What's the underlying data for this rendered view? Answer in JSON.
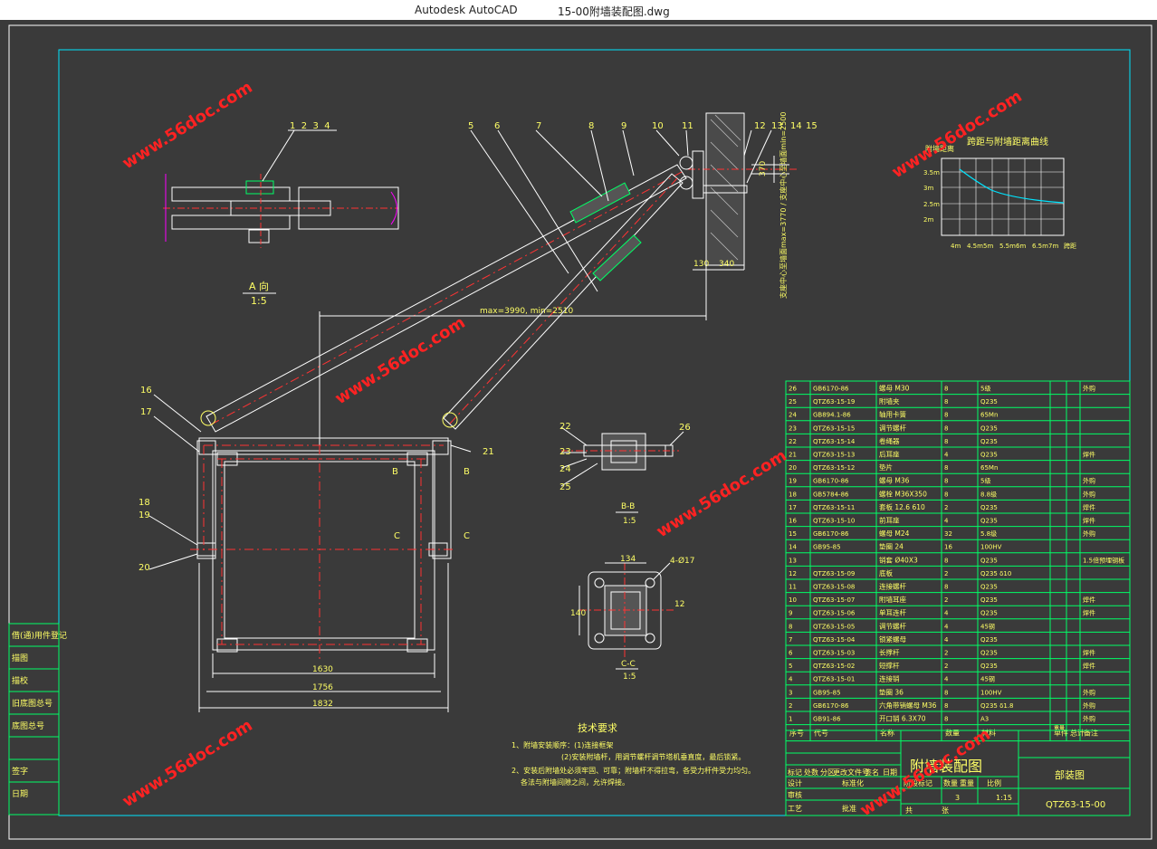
{
  "window": {
    "app_name": "Autodesk AutoCAD",
    "file_name": "15-00附墙装配图.dwg"
  },
  "drawing": {
    "view_a_label": "A 向",
    "view_a_scale": "1:5",
    "callouts_top": [
      "1",
      "2",
      "3",
      "4",
      "5",
      "6",
      "7",
      "8",
      "9",
      "10",
      "11",
      "12",
      "13",
      "14",
      "15"
    ],
    "callouts_left": [
      "16",
      "17",
      "18",
      "19",
      "20"
    ],
    "callout_21": "21",
    "section_b_callouts": [
      "22",
      "23",
      "24",
      "25",
      "26"
    ],
    "dim_reach": "max=3990, min=2510",
    "dim_wall_left": "130",
    "dim_wall_right": "340",
    "dim_vertical_1": "370",
    "dim_vertical_note": "支座中心至墙面max=3770 / 支座中心至墙面min=2500",
    "dim_1630": "1630",
    "dim_1756": "1756",
    "dim_1832": "1832",
    "mark_b": "B",
    "mark_c": "C",
    "section_bb_label": "B-B",
    "section_bb_scale": "1:5",
    "section_cc_label": "C-C",
    "section_cc_scale": "1:5",
    "section_cc_hole": "4-Ø17",
    "section_cc_dim_top": "134",
    "section_cc_dim_left": "140",
    "section_cc_dim_right": "12",
    "chart_title": "跨距与附墙距离曲线",
    "chart_ylabel": "附墙距离",
    "chart_yticks": [
      "3.5m",
      "3m",
      "2.5m",
      "2m"
    ],
    "chart_xticks": [
      "4m",
      "4.5m",
      "5m",
      "5.5m",
      "6m",
      "6.5m",
      "7m",
      "跨距"
    ]
  },
  "tech": {
    "title": "技术要求",
    "lines": [
      "1、附墙安装顺序：(1)连接框架",
      "(2)安装附墙杆，用调节螺杆调节塔机垂直度，最后锁紧。",
      "2、安装后附墙处必须牢固、可靠；附墙杆不得拉弯，各受力杆件受力均匀。",
      "各法与附墙间隙之间，允许焊接。"
    ]
  },
  "bom": {
    "header": [
      "序号",
      "代号",
      "名称",
      "数量",
      "材料",
      "单件",
      "总计",
      "备注"
    ],
    "header_weight": "重量",
    "rows": [
      [
        "26",
        "GB6170-86",
        "螺母 M30",
        "8",
        "5级",
        "",
        "",
        "外购"
      ],
      [
        "25",
        "QTZ63-15-19",
        "附墙夹",
        "8",
        "Q235",
        "",
        "",
        ""
      ],
      [
        "24",
        "GB894.1-86",
        "轴用卡簧",
        "8",
        "65Mn",
        "",
        "",
        ""
      ],
      [
        "23",
        "QTZ63-15-15",
        "调节螺杆",
        "8",
        "Q235",
        "",
        "",
        ""
      ],
      [
        "22",
        "QTZ63-15-14",
        "卷绳器",
        "8",
        "Q235",
        "",
        "",
        ""
      ],
      [
        "21",
        "QTZ63-15-13",
        "后耳座",
        "4",
        "Q235",
        "",
        "",
        "焊件"
      ],
      [
        "20",
        "QTZ63-15-12",
        "垫片",
        "8",
        "65Mn",
        "",
        "",
        ""
      ],
      [
        "19",
        "GB6170-86",
        "螺母 M36",
        "8",
        "5级",
        "",
        "",
        "外购"
      ],
      [
        "18",
        "GB5784-86",
        "螺栓 M36X350",
        "8",
        "8.8级",
        "",
        "",
        "外购"
      ],
      [
        "17",
        "QTZ63-15-11",
        "套板 12.6 610",
        "2",
        "Q235",
        "",
        "",
        "焊件"
      ],
      [
        "16",
        "QTZ63-15-10",
        "前耳座",
        "4",
        "Q235",
        "",
        "",
        "焊件"
      ],
      [
        "15",
        "GB6170-86",
        "螺母 M24",
        "32",
        "5.8级",
        "",
        "",
        "外购"
      ],
      [
        "14",
        "GB95-85",
        "垫圈 24",
        "16",
        "100HV",
        "",
        "",
        ""
      ],
      [
        "13",
        "",
        "销套 Ø40X3",
        "8",
        "Q235",
        "",
        "",
        "1.5倍预埋钢板"
      ],
      [
        "12",
        "QTZ63-15-09",
        "底板",
        "2",
        "Q235 δ10",
        "",
        "",
        ""
      ],
      [
        "11",
        "QTZ63-15-08",
        "连接螺杆",
        "8",
        "Q235",
        "",
        "",
        ""
      ],
      [
        "10",
        "QTZ63-15-07",
        "附墙耳座",
        "2",
        "Q235",
        "",
        "",
        "焊件"
      ],
      [
        "9",
        "QTZ63-15-06",
        "单耳连杆",
        "4",
        "Q235",
        "",
        "",
        "焊件"
      ],
      [
        "8",
        "QTZ63-15-05",
        "调节螺杆",
        "4",
        "45钢",
        "",
        "",
        ""
      ],
      [
        "7",
        "QTZ63-15-04",
        "锁紧螺母",
        "4",
        "Q235",
        "",
        "",
        ""
      ],
      [
        "6",
        "QTZ63-15-03",
        "长撑杆",
        "2",
        "Q235",
        "",
        "",
        "焊件"
      ],
      [
        "5",
        "QTZ63-15-02",
        "短撑杆",
        "2",
        "Q235",
        "",
        "",
        "焊件"
      ],
      [
        "4",
        "QTZ63-15-01",
        "连接销",
        "4",
        "45钢",
        "",
        "",
        ""
      ],
      [
        "3",
        "GB95-85",
        "垫圈 36",
        "8",
        "100HV",
        "",
        "",
        "外购"
      ],
      [
        "2",
        "GB6170-86",
        "六角带销螺母 M36",
        "8",
        "Q235 δ1.8",
        "",
        "",
        "外购"
      ],
      [
        "1",
        "GB91-86",
        "开口销 6.3X70",
        "8",
        "A3",
        "",
        "",
        "外购"
      ]
    ]
  },
  "title_block": {
    "drawing_name": "附墙装配图",
    "drawing_type": "部装图",
    "drawing_no": "QTZ63-15-00",
    "scale": "1:15",
    "sheet_count": "3",
    "labels_left": [
      "标记",
      "处数",
      "分区",
      "更改文件号",
      "签名",
      "日期"
    ],
    "labels_sign": [
      "设计",
      "审核",
      "工艺"
    ],
    "labels_right": [
      "阶段标记",
      "数量",
      "重量",
      "比例"
    ],
    "sheet_label": "共",
    "sheet_label2": "张",
    "std_label": "标准化",
    "approve_label": "批准",
    "date_label": "日期"
  },
  "left_strip": [
    "借(通)用件登记",
    "描图",
    "描校",
    "旧底图总号",
    "底图总号",
    "签字",
    "日期"
  ],
  "watermark": "www.56doc.com"
}
